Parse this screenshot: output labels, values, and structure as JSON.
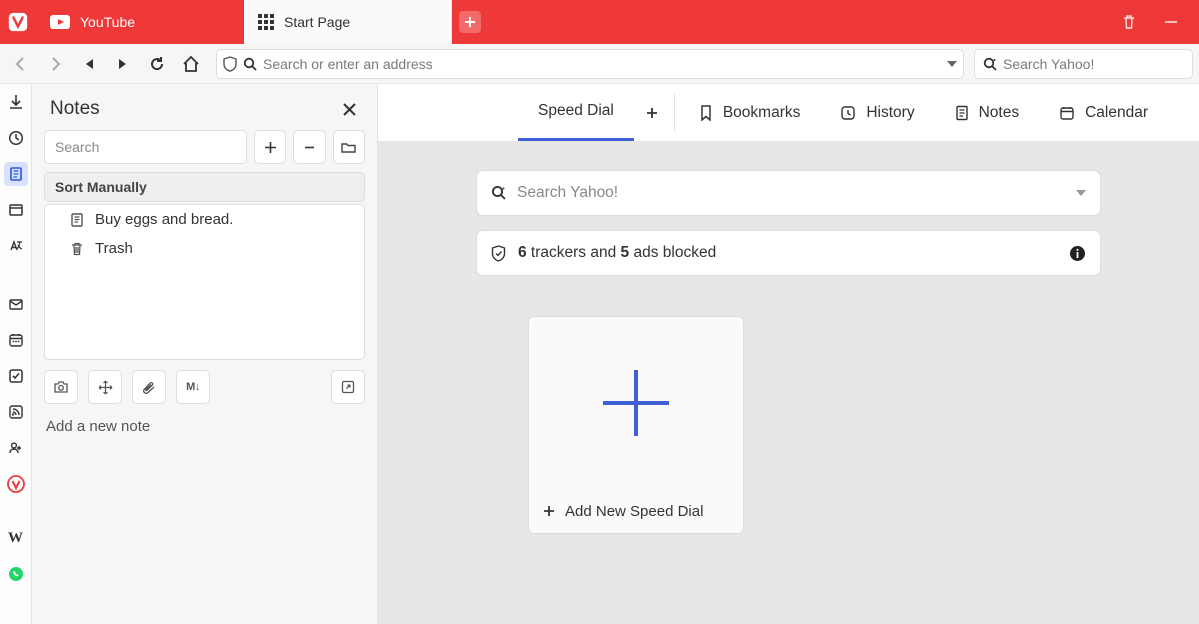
{
  "tabs": {
    "youtube": "YouTube",
    "startpage": "Start Page"
  },
  "address": {
    "placeholder": "Search or enter an address",
    "yahoo_placeholder": "Search Yahoo!"
  },
  "panel": {
    "title": "Notes",
    "search_placeholder": "Search",
    "sort_label": "Sort Manually",
    "items": [
      {
        "label": "Buy eggs and bread."
      },
      {
        "label": "Trash"
      }
    ],
    "new_note": "Add a new note"
  },
  "content_tabs": {
    "speed_dial": "Speed Dial",
    "bookmarks": "Bookmarks",
    "history": "History",
    "notes": "Notes",
    "calendar": "Calendar"
  },
  "speed_dial": {
    "search_placeholder": "Search Yahoo!",
    "privacy_trackers": "6",
    "privacy_trackers_text": " trackers and ",
    "privacy_ads": "5",
    "privacy_ads_text": " ads blocked",
    "add_label": "Add New Speed Dial"
  }
}
